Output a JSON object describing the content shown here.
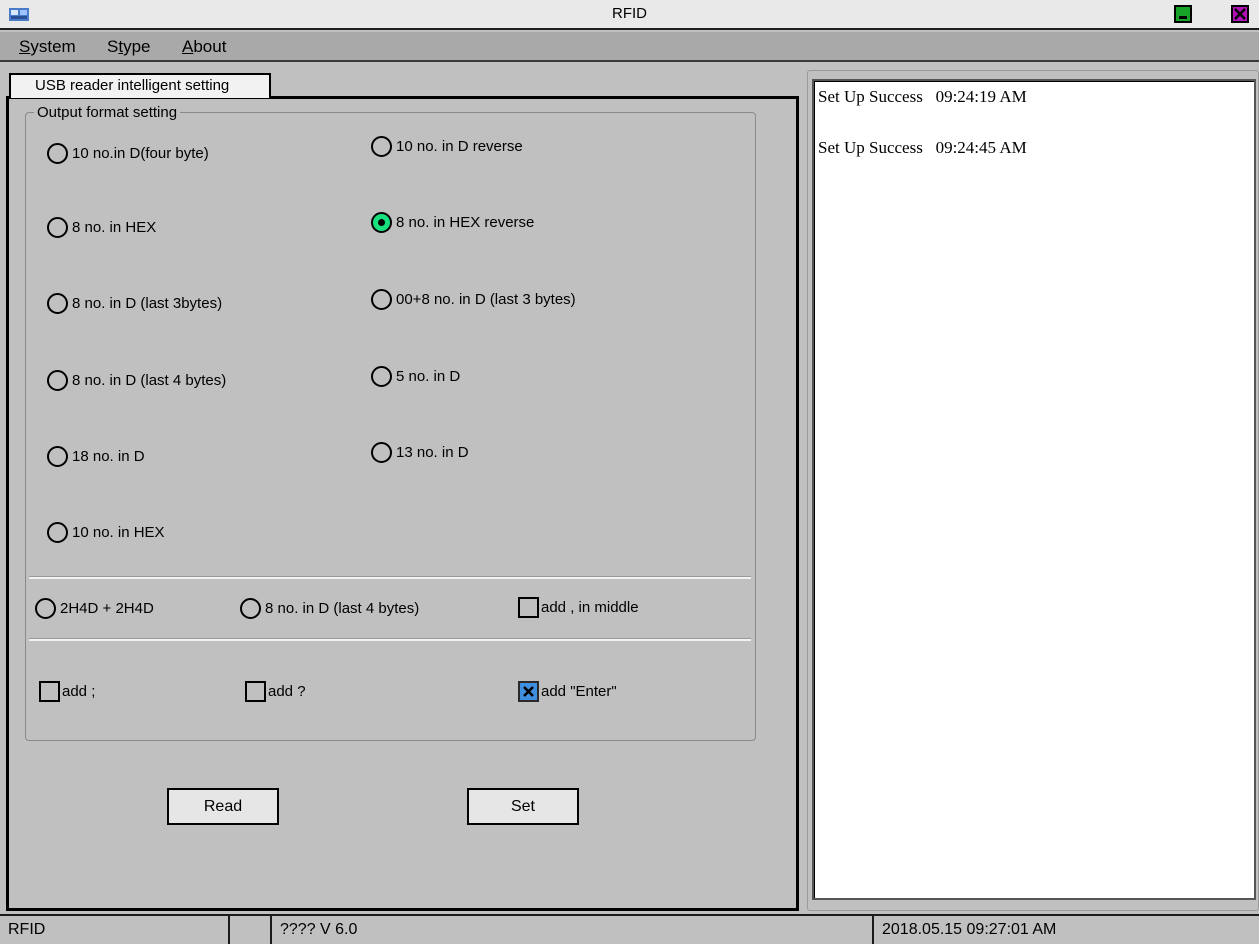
{
  "window": {
    "title": "RFID"
  },
  "menu": [
    {
      "label": "System",
      "underline_index": 0
    },
    {
      "label": "Stype",
      "underline_index": 1
    },
    {
      "label": "About",
      "underline_index": 0
    }
  ],
  "tab": {
    "label": "USB reader intelligent setting"
  },
  "group": {
    "title": "Output format setting"
  },
  "radios": [
    {
      "label": "10 no.in D(four byte)",
      "checked": false
    },
    {
      "label": "10 no. in D reverse",
      "checked": false
    },
    {
      "label": "8 no. in HEX",
      "checked": false
    },
    {
      "label": "8 no. in HEX reverse",
      "checked": true
    },
    {
      "label": " 8 no. in D (last 3bytes)",
      "checked": false
    },
    {
      "label": " 00+8 no. in D (last 3 bytes)",
      "checked": false
    },
    {
      "label": "8 no. in D (last 4 bytes)",
      "checked": false
    },
    {
      "label": "5 no. in D",
      "checked": false
    },
    {
      "label": "18 no. in D",
      "checked": false
    },
    {
      "label": "13 no. in D",
      "checked": false
    },
    {
      "label": "10 no. in HEX",
      "checked": false
    },
    {
      "label": "2H4D + 2H4D",
      "checked": false
    },
    {
      "label": "8 no. in D (last 4 bytes)",
      "checked": false
    }
  ],
  "checkboxes": [
    {
      "label": "add , in middle",
      "checked": false
    },
    {
      "label": "add ;",
      "checked": false
    },
    {
      "label": "add ?",
      "checked": false
    },
    {
      "label": "add \"Enter\"",
      "checked": true
    }
  ],
  "buttons": {
    "read": "Read",
    "set": "Set"
  },
  "log": [
    "Set Up Success   09:24:19 AM",
    "Set Up Success   09:24:45 AM"
  ],
  "status": {
    "app": "RFID",
    "empty": "",
    "version": "????  V 6.0",
    "datetime": "2018.05.15  09:27:01 AM"
  },
  "colors": {
    "radio_selected": "#19e07f",
    "checkbox_checked": "#3f8fe0",
    "minimize": "#17a327",
    "close": "#b012b8"
  }
}
